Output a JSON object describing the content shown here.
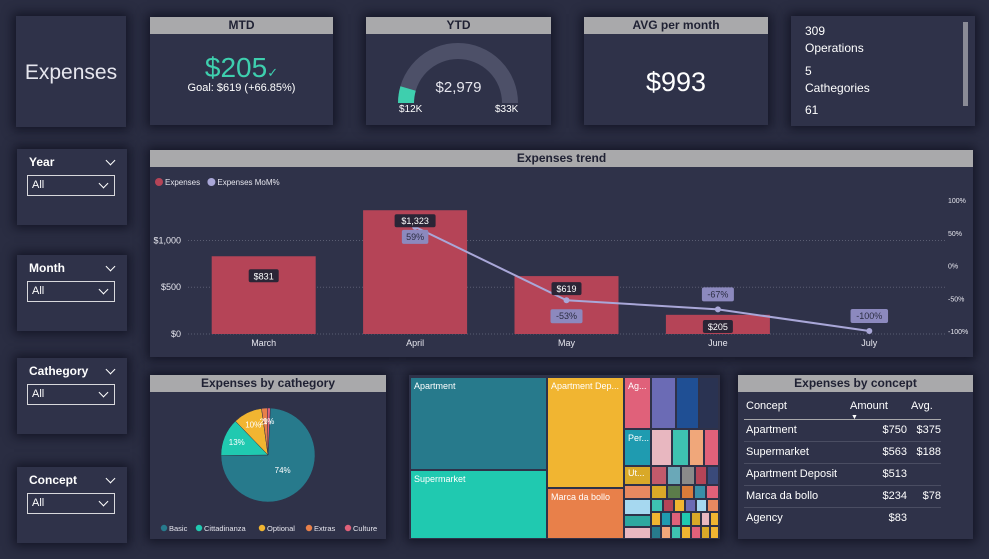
{
  "page_title": "Expenses",
  "kpis": {
    "mtd": {
      "title": "MTD",
      "value": "$205",
      "check": "✓",
      "goal": "Goal: $619 (+66.85%)"
    },
    "ytd": {
      "title": "YTD",
      "value": "$2,979",
      "min_label": "$12K",
      "max_label": "$33K",
      "fill_fraction": 0.09
    },
    "avg": {
      "title": "AVG per month",
      "value": "$993"
    },
    "counts": [
      {
        "value": "309",
        "label": "Operations"
      },
      {
        "value": "5",
        "label": "Cathegories"
      },
      {
        "value": "61",
        "label": ""
      }
    ]
  },
  "slicers": [
    {
      "title": "Year",
      "value": "All"
    },
    {
      "title": "Month",
      "value": "All"
    },
    {
      "title": "Cathegory",
      "value": "All"
    },
    {
      "title": "Concept",
      "value": "All"
    }
  ],
  "trend": {
    "title": "Expenses trend",
    "legend": [
      {
        "name": "Expenses",
        "color": "#b54457"
      },
      {
        "name": "Expenses MoM%",
        "color": "#a9a7d8"
      }
    ]
  },
  "category_chart": {
    "title": "Expenses by cathegory"
  },
  "concept_table": {
    "title": "Expenses by concept",
    "headers": [
      "Concept",
      "Amount",
      "Avg."
    ],
    "rows": [
      {
        "concept": "Apartment",
        "amount": "$750",
        "avg": "$375"
      },
      {
        "concept": "Supermarket",
        "amount": "$563",
        "avg": "$188"
      },
      {
        "concept": "Apartment Deposit",
        "amount": "$513",
        "avg": ""
      },
      {
        "concept": "Marca da bollo",
        "amount": "$234",
        "avg": "$78"
      },
      {
        "concept": "Agency",
        "amount": "$83",
        "avg": ""
      }
    ]
  },
  "treemap": {
    "labels": {
      "apartment": "Apartment",
      "supermarket": "Supermarket",
      "apartment_deposit": "Apartment Dep...",
      "marca": "Marca da bollo",
      "ag": "Ag...",
      "per": "Per...",
      "ut": "Ut..."
    }
  },
  "colors": {
    "background": "#2a2d42",
    "card": "#2f3249",
    "bar": "#b54457",
    "line": "#a9a7d8",
    "accent_green": "#3ecfae"
  },
  "chart_data": [
    {
      "type": "bar",
      "title": "Expenses trend",
      "categories": [
        "March",
        "April",
        "May",
        "June",
        "July"
      ],
      "series": [
        {
          "name": "Expenses",
          "type": "bar",
          "values": [
            831,
            1323,
            619,
            205,
            null
          ],
          "labels": [
            "$831",
            "$1,323",
            "$619",
            "$205",
            ""
          ]
        },
        {
          "name": "Expenses MoM%",
          "type": "line",
          "axis": "right",
          "values": [
            null,
            59,
            -53,
            -67,
            -100
          ],
          "labels": [
            "",
            "59%",
            "-53%",
            "-67%",
            "-100%"
          ]
        }
      ],
      "y_left": {
        "ticks": [
          0,
          500,
          1000
        ],
        "tick_labels": [
          "$0",
          "$500",
          "$1,000"
        ],
        "range": [
          0,
          1550
        ]
      },
      "y_right": {
        "ticks": [
          100,
          50,
          0,
          -50,
          -100
        ],
        "tick_labels": [
          "100%",
          "50%",
          "0%",
          "-50%",
          "-100%"
        ],
        "range": [
          -100,
          100
        ]
      },
      "legend": "top-left",
      "grid": true
    },
    {
      "type": "pie",
      "title": "Expenses by cathegory",
      "slices": [
        {
          "name": "Basic",
          "value": 74,
          "label": "74%",
          "color": "#277a8c"
        },
        {
          "name": "Cittadinanza",
          "value": 13,
          "label": "13%",
          "color": "#20c9b0"
        },
        {
          "name": "Optional",
          "value": 10,
          "label": "10%",
          "color": "#f1b531"
        },
        {
          "name": "Extras",
          "value": 2,
          "label": "2%",
          "color": "#e8804a"
        },
        {
          "name": "Culture",
          "value": 1,
          "label": "1%",
          "color": "#e0617a"
        }
      ],
      "legend": "bottom"
    }
  ]
}
